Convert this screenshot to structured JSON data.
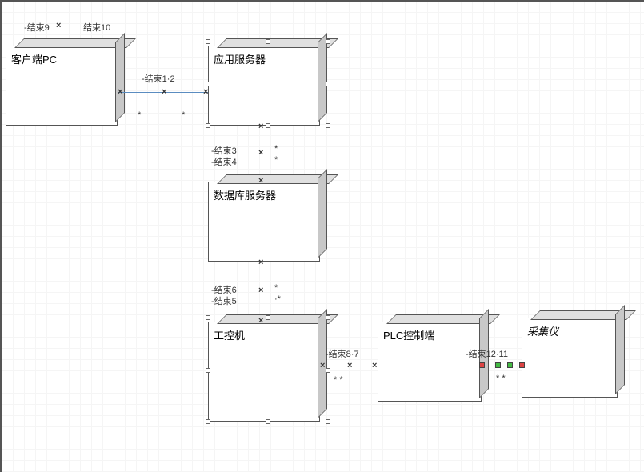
{
  "boxes": {
    "client_pc": "客户端PC",
    "app_server": "应用服务器",
    "db_server": "数据库服务器",
    "ipc": "工控机",
    "plc": "PLC控制端",
    "collector": "采集仪"
  },
  "labels": {
    "end9": "-结束9",
    "end10": "结束10",
    "end12": "-结束1·2",
    "end34": "-结束3",
    "end4": "-结束4",
    "end56": "-结束6",
    "end5": "-结束5",
    "end78": "-结束8·7",
    "end1112": "-结束12·11"
  },
  "mult": {
    "star": "*",
    "starstar": "* *",
    "dotstar": "·*"
  }
}
